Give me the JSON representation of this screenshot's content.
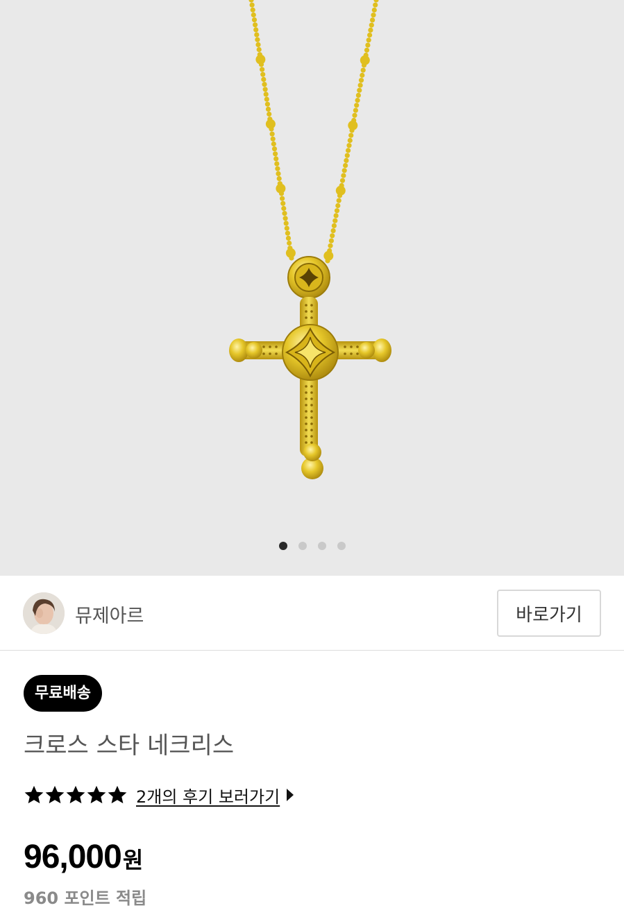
{
  "carousel": {
    "image_alt": "cross-necklace-product-photo",
    "dot_count": 4,
    "active_index": 0
  },
  "shop": {
    "name": "뮤제아르",
    "goto_label": "바로가기"
  },
  "product": {
    "badge": "무료배송",
    "title": "크로스 스타 네크리스",
    "rating": 5,
    "review_link": "2개의 후기 보러가기",
    "price": "96,000",
    "price_unit": "원",
    "points": "960 포인트 적립"
  },
  "colors": {
    "hero_bg": "#e9e9e9",
    "gold": "#e2c21e",
    "badge_bg": "#000000",
    "points_text": "#8a8a8a"
  }
}
